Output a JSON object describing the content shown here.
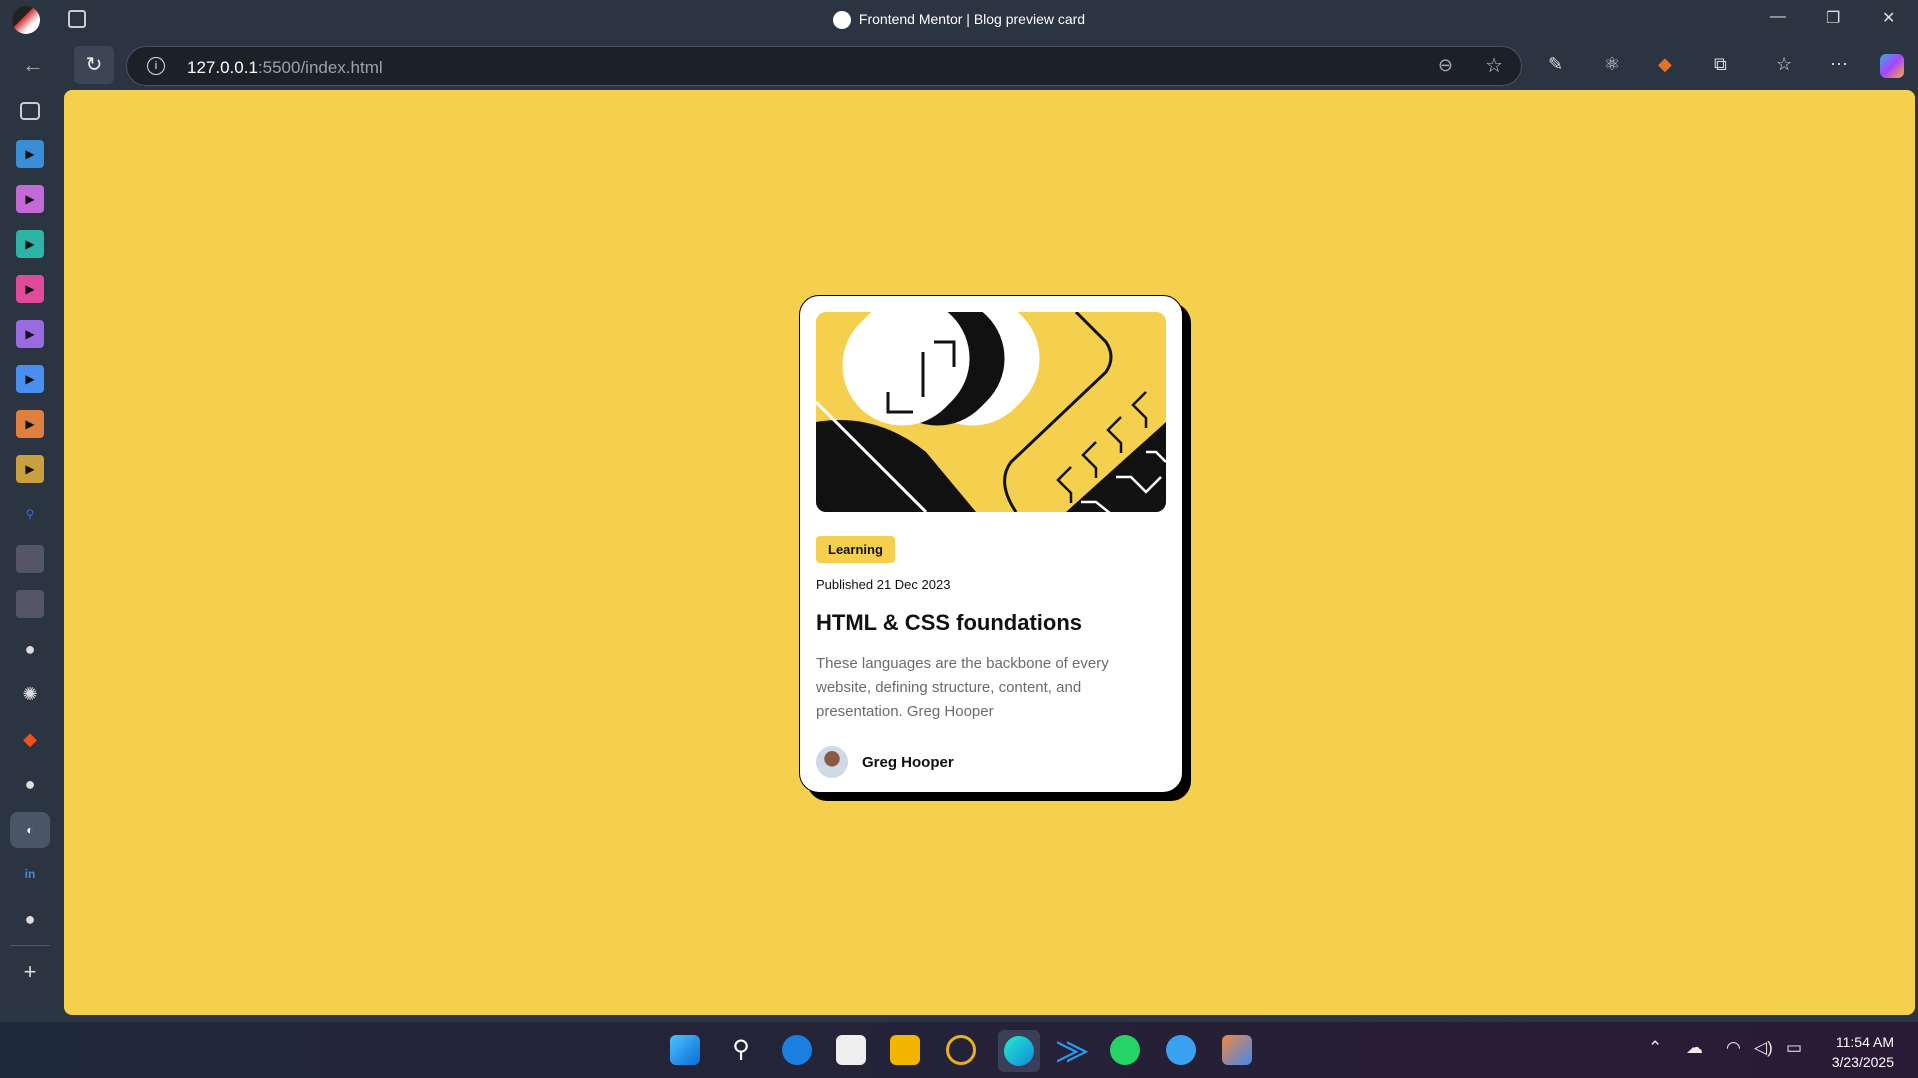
{
  "browser": {
    "title": "Frontend Mentor | Blog preview card",
    "url_host": "127.0.0.1",
    "url_rest": ":5500/index.html"
  },
  "card": {
    "tag": "Learning",
    "published": "Published 21 Dec 2023",
    "title": "HTML & CSS foundations",
    "description": "These languages are the backbone of every website, defining structure, content, and presentation. Greg Hooper",
    "author": "Greg Hooper"
  },
  "taskbar": {
    "time": "11:54 AM",
    "date": "3/23/2025"
  },
  "colors": {
    "accent": "#f4d04e",
    "sidebar_apps": [
      "#3a8ed6",
      "#c46ad6",
      "#2db3a5",
      "#e04a9a",
      "#9a6ae0",
      "#4a8ef0",
      "#e08040",
      "#c8a040"
    ]
  }
}
